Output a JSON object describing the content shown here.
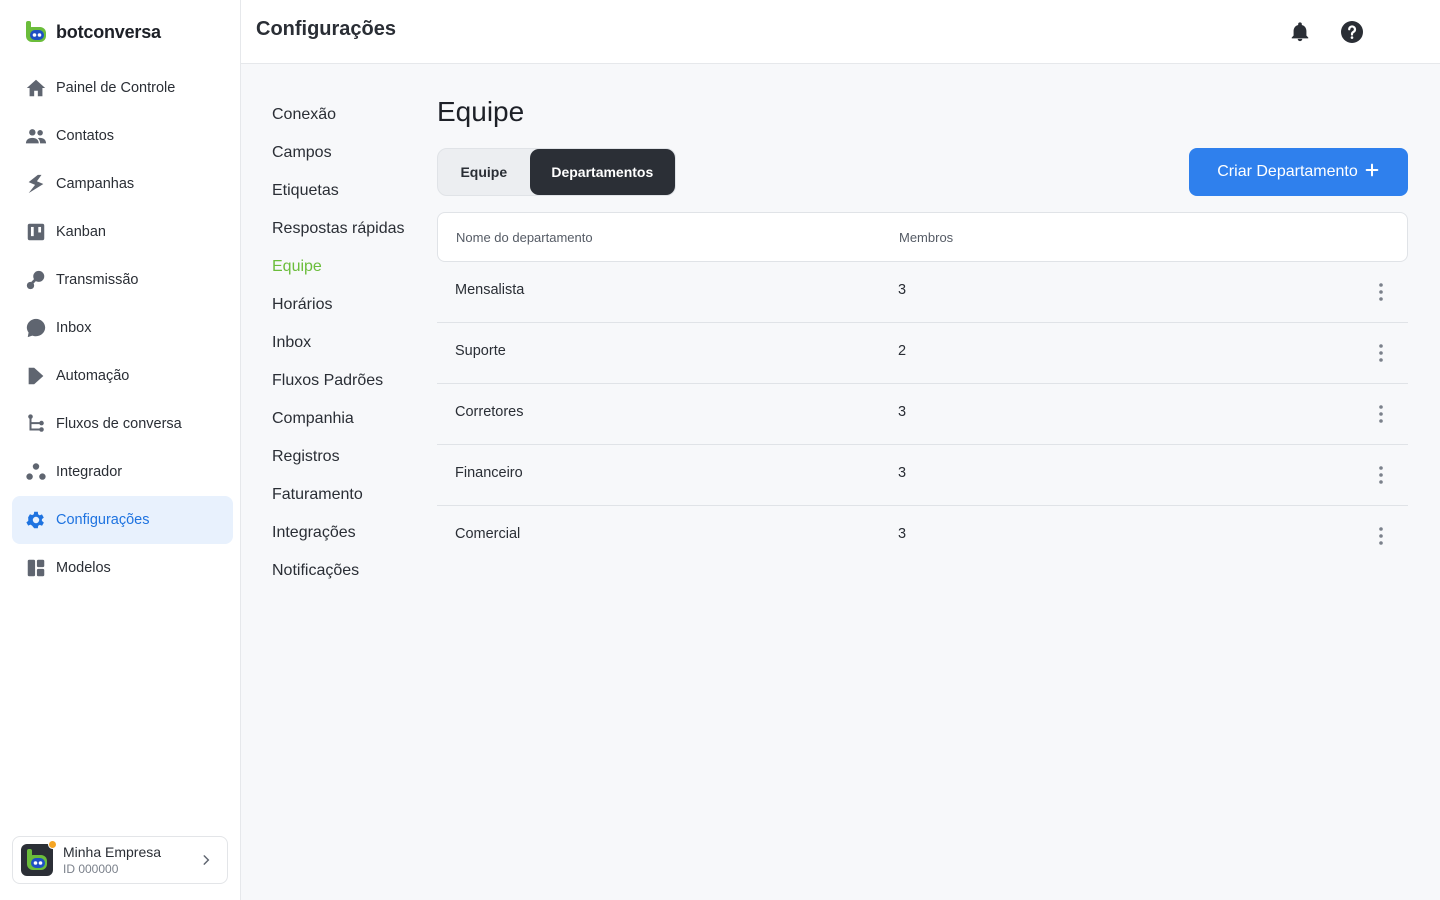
{
  "brand": {
    "name": "botconversa"
  },
  "sidebar": {
    "items": [
      {
        "label": "Painel de Controle",
        "icon": "home-icon"
      },
      {
        "label": "Contatos",
        "icon": "people-icon"
      },
      {
        "label": "Campanhas",
        "icon": "campaign-icon"
      },
      {
        "label": "Kanban",
        "icon": "kanban-icon"
      },
      {
        "label": "Transmissão",
        "icon": "broadcast-icon"
      },
      {
        "label": "Inbox",
        "icon": "chat-bubble-icon"
      },
      {
        "label": "Automação",
        "icon": "automation-icon"
      },
      {
        "label": "Fluxos de conversa",
        "icon": "flow-icon"
      },
      {
        "label": "Integrador",
        "icon": "integrator-icon"
      },
      {
        "label": "Configurações",
        "icon": "gear-icon",
        "active": true
      },
      {
        "label": "Modelos",
        "icon": "templates-icon"
      }
    ]
  },
  "company": {
    "name": "Minha Empresa",
    "id": "ID 000000"
  },
  "header": {
    "title": "Configurações"
  },
  "settings_menu": {
    "items": [
      "Conexão",
      "Campos",
      "Etiquetas",
      "Respostas rápidas",
      "Equipe",
      "Horários",
      "Inbox",
      "Fluxos Padrões",
      "Companhia",
      "Registros",
      "Faturamento",
      "Integrações",
      "Notificações"
    ],
    "active": "Equipe"
  },
  "main": {
    "title": "Equipe",
    "tabs": {
      "team": "Equipe",
      "departments": "Departamentos"
    },
    "active_tab": "Departamentos",
    "create_button": "Criar Departamento",
    "table": {
      "columns": {
        "name": "Nome do departamento",
        "members": "Membros"
      },
      "rows": [
        {
          "name": "Mensalista",
          "members": "3"
        },
        {
          "name": "Suporte",
          "members": "2"
        },
        {
          "name": "Corretores",
          "members": "3"
        },
        {
          "name": "Financeiro",
          "members": "3"
        },
        {
          "name": "Comercial",
          "members": "3"
        }
      ]
    }
  },
  "colors": {
    "accent": "#2f80ed",
    "active_nav": "#1e73e0",
    "active_submenu": "#6bbd3b",
    "dark_tab": "#2b2f36"
  }
}
